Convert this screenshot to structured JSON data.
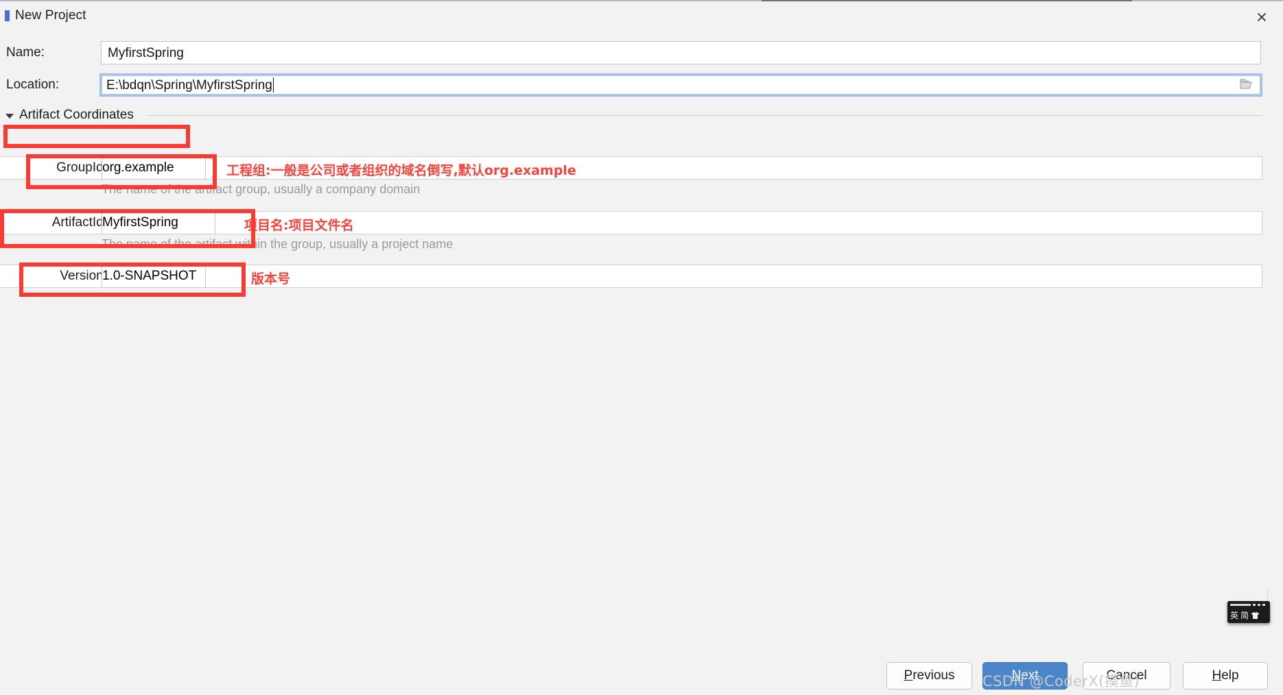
{
  "window": {
    "title": "New Project",
    "close_icon": "close-icon",
    "app_icon": "intellij-project-icon"
  },
  "form": {
    "name": {
      "label": "Name:",
      "value": "MyfirstSpring",
      "placeholder": "",
      "focused": false
    },
    "location": {
      "label": "Location:",
      "value": "E:\\bdqn\\Spring\\MyfirstSpring",
      "placeholder": "",
      "focused": true,
      "browse_icon": "folder-icon"
    }
  },
  "artifact_section": {
    "title": "Artifact Coordinates",
    "expanded": true,
    "expand_icon": "chevron-down-icon",
    "fields": [
      {
        "label": "GroupId:",
        "value": "org.example",
        "hint": "The name of the artifact group, usually a company domain",
        "annotation": "工程组:一般是公司或者组织的域名倒写,默认org.example",
        "highlighted": true
      },
      {
        "label": "ArtifactId:",
        "value": "MyfirstSpring",
        "hint": "The name of the artifact within the group, usually a project name",
        "annotation": "项目名:项目文件名",
        "highlighted": true
      },
      {
        "label": "Version:",
        "value": "1.0-SNAPSHOT",
        "hint": "",
        "annotation": "版本号",
        "highlighted": true
      }
    ]
  },
  "footer": {
    "buttons": [
      {
        "label": "Previous",
        "mnemonic": "P",
        "primary": false
      },
      {
        "label": "Next",
        "mnemonic": "N",
        "primary": true
      },
      {
        "label": "Cancel",
        "mnemonic": "",
        "primary": false
      },
      {
        "label": "Help",
        "mnemonic": "H",
        "primary": false
      }
    ]
  },
  "ime": {
    "mode_lang": "英",
    "mode_shape": "简",
    "icon": "shirt-icon"
  },
  "watermark": "CSDN @CoderX(摸鱼)",
  "colors": {
    "annotation_red": "#f4443c",
    "highlight_box_red": "#fa3b33",
    "primary_button": "#4a86c8",
    "focus_border": "#a8c6ec",
    "dialog_background": "#f2f2f2",
    "hint_text": "#9a9a9a"
  }
}
